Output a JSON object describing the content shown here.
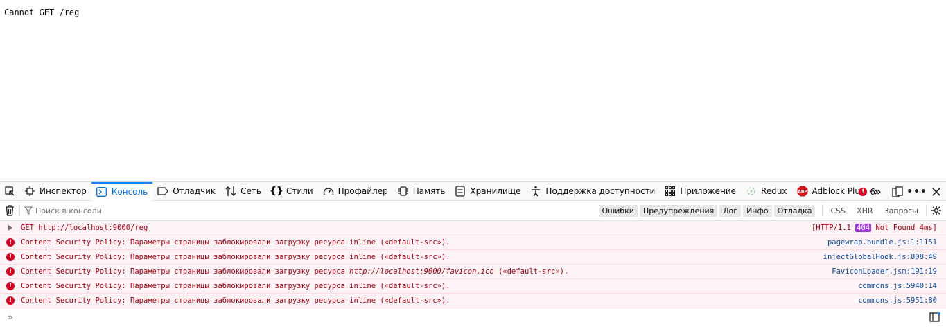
{
  "page": {
    "text": "Cannot GET /reg"
  },
  "tabs": [
    {
      "label": "Инспектор",
      "icon": "inspector-icon"
    },
    {
      "label": "Консоль",
      "icon": "console-icon"
    },
    {
      "label": "Отладчик",
      "icon": "debugger-icon"
    },
    {
      "label": "Сеть",
      "icon": "network-icon"
    },
    {
      "label": "Стили",
      "icon": "style-editor-icon"
    },
    {
      "label": "Профайлер",
      "icon": "profiler-icon"
    },
    {
      "label": "Память",
      "icon": "memory-icon"
    },
    {
      "label": "Хранилище",
      "icon": "storage-icon"
    },
    {
      "label": "Поддержка доступности",
      "icon": "accessibility-icon"
    },
    {
      "label": "Приложение",
      "icon": "application-icon"
    },
    {
      "label": "Redux",
      "icon": "redux-icon"
    },
    {
      "label": "Adblock Plus",
      "icon": "abp-icon"
    }
  ],
  "error_count": "6",
  "filter": {
    "placeholder": "Поиск в консоли",
    "levels": [
      "Ошибки",
      "Предупреждения",
      "Лог",
      "Инфо",
      "Отладка"
    ],
    "types": [
      "CSS",
      "XHR",
      "Запросы"
    ]
  },
  "log": {
    "request": {
      "text": "GET http://localhost:9000/reg",
      "status_prefix": "[HTTP/1.1",
      "status_code": "404",
      "status_suffix": "Not Found 4ms]"
    },
    "csp_prefix": "Content Security Policy: Параметры страницы заблокировали загрузку ресурса",
    "rows": [
      {
        "resource": "inline",
        "suffix": "(«default-src»).",
        "location": "pagewrap.bundle.js:1:1151"
      },
      {
        "resource": "inline",
        "suffix": "(«default-src»).",
        "location": "injectGlobalHook.js:808:49"
      },
      {
        "resource": "http://localhost:9000/favicon.ico",
        "suffix": "(«default-src»).",
        "location": "FaviconLoader.jsm:191:19"
      },
      {
        "resource": "inline",
        "suffix": "(«default-src»).",
        "location": "commons.js:5940:14"
      },
      {
        "resource": "inline",
        "suffix": "(«default-src»).",
        "location": "commons.js:5951:80"
      }
    ]
  }
}
